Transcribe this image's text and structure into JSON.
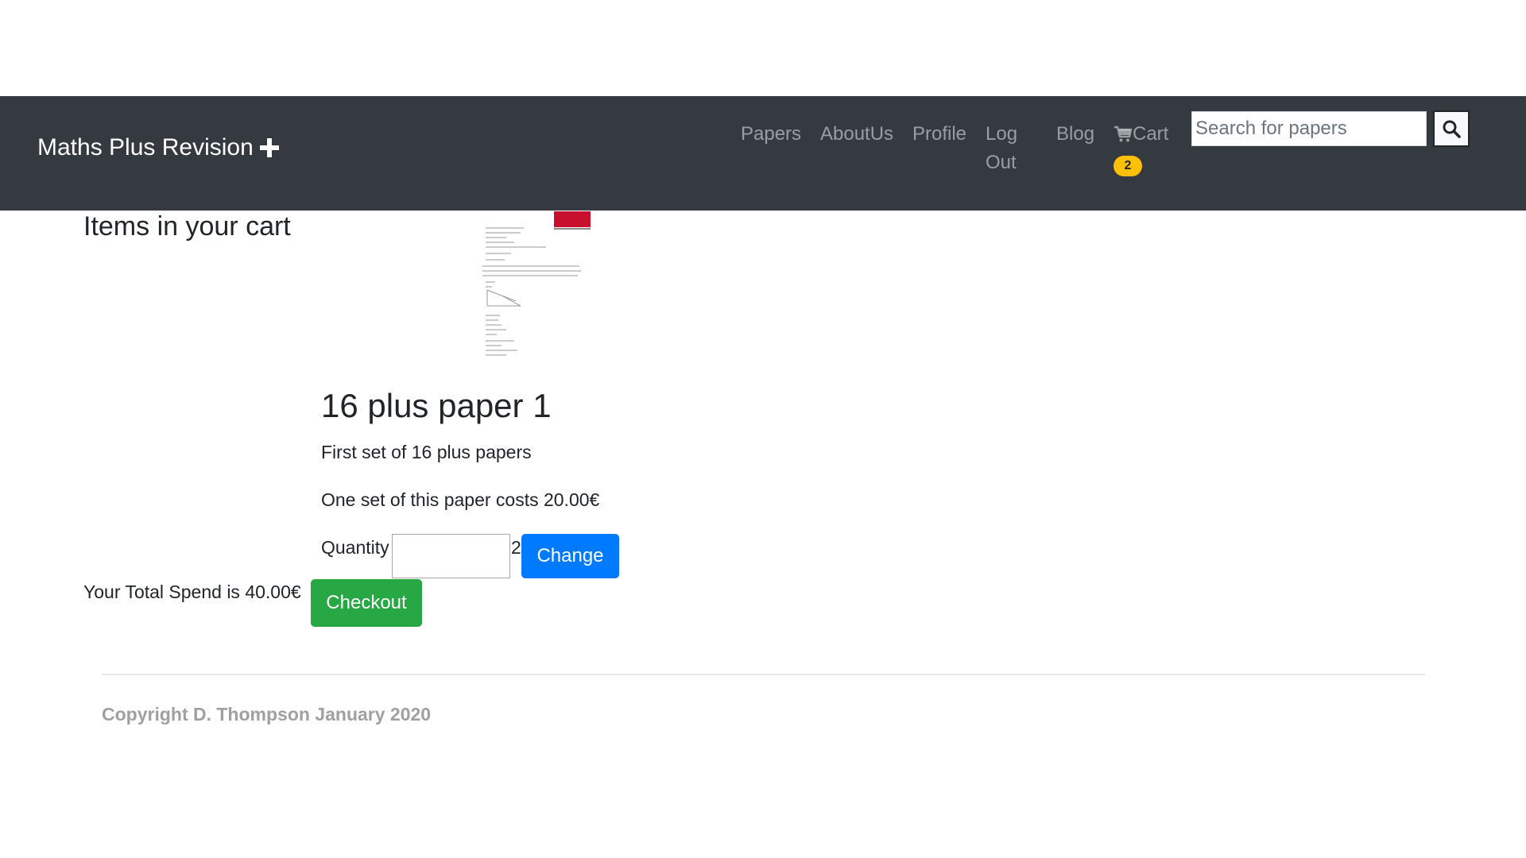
{
  "navbar": {
    "brand": "Maths Plus Revision",
    "links": {
      "papers": "Papers",
      "about": "AboutUs",
      "profile": "Profile",
      "logout": "Log Out",
      "blog": "Blog",
      "cart": "Cart"
    },
    "cart_count": "2",
    "search_placeholder": "Search for papers",
    "background": "#343a40"
  },
  "cart": {
    "heading": "Items in your cart",
    "items": [
      {
        "title": "16 plus paper 1",
        "description": "First set of 16 plus papers",
        "price_text": "One set of this paper costs 20.00€",
        "quantity_label": "Quantity",
        "quantity_value": "2",
        "change_label": "Change"
      }
    ],
    "total_text": "Your Total Spend is 40.00€",
    "checkout_label": "Checkout"
  },
  "footer": {
    "copyright": "Copyright D. Thompson January 2020"
  },
  "colors": {
    "primary": "#007bff",
    "success": "#28a745",
    "warning": "#ffc107"
  }
}
